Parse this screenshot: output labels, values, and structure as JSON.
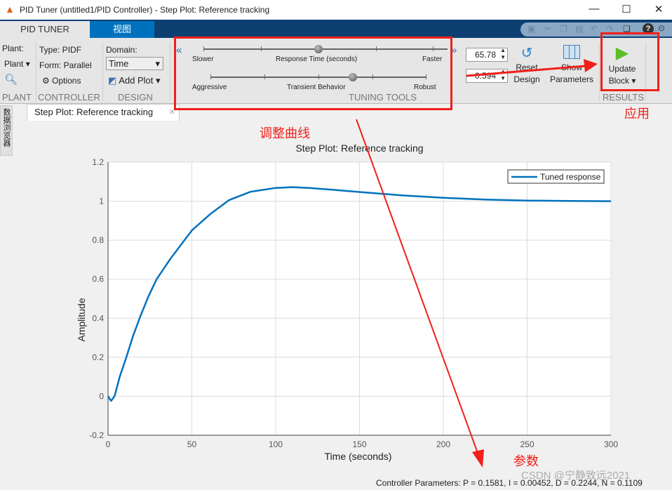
{
  "window": {
    "title": "PID Tuner (untitled1/PID Controller) - Step Plot: Reference tracking",
    "minimize": "—",
    "maximize": "☐",
    "close": "✕"
  },
  "tabs": [
    {
      "label": "PID TUNER"
    },
    {
      "label": "视图"
    }
  ],
  "plant": {
    "label": "Plant:",
    "dropdown": "Plant",
    "section": "PLANT"
  },
  "controller": {
    "type": "Type: PIDF",
    "form": "Form: Parallel",
    "options": "Options",
    "section": "CONTROLLER"
  },
  "design": {
    "domain_label": "Domain:",
    "domain_value": "Time",
    "add_plot": "Add Plot",
    "section": "DESIGN"
  },
  "tuning": {
    "response_left": "Slower",
    "response_mid": "Response Time (seconds)",
    "response_right": "Faster",
    "response_value": 65.78,
    "transient_left": "Aggressive",
    "transient_mid": "Transient Behavior",
    "transient_right": "Robust",
    "transient_value": 0.594,
    "section": "TUNING TOOLS",
    "response_field": "65.78",
    "transient_field": "0.594"
  },
  "actions": {
    "reset_line1": "Reset",
    "reset_line2": "Design",
    "show_line1": "Show",
    "show_line2": "Parameters",
    "update_line1": "Update",
    "update_line2": "Block",
    "section": "RESULTS"
  },
  "sidebar": {
    "label": "数据浏览器"
  },
  "doc_tab": {
    "label": "Step Plot: Reference tracking",
    "close": "✕"
  },
  "annotations": {
    "tune_curve": "调整曲线",
    "apply": "应用",
    "params": "参数",
    "accent": "#f0201a"
  },
  "watermark": "CSDN @宁静致远2021",
  "status": "Controller Parameters: P = 0.1581, I = 0.00452, D = 0.2244, N = 0.1109",
  "chart_data": {
    "type": "line",
    "title": "Step Plot: Reference tracking",
    "xlabel": "Time (seconds)",
    "ylabel": "Amplitude",
    "xlim": [
      0,
      300
    ],
    "ylim": [
      -0.2,
      1.2
    ],
    "grid": true,
    "legend_placement": "top-right",
    "xticks": [
      "0",
      "50",
      "100",
      "150",
      "200",
      "250",
      "300"
    ],
    "yticks": [
      "-0.2",
      "0",
      "0.2",
      "0.4",
      "0.6",
      "0.8",
      "1",
      "1.2"
    ],
    "series": [
      {
        "name": "Tuned response",
        "color": "#0072bd",
        "x": [
          0,
          1.8,
          3.9,
          7,
          10.9,
          15,
          19.3,
          24,
          29,
          37.4,
          50,
          61,
          72.3,
          85,
          100,
          110,
          120,
          135,
          150,
          175,
          200,
          225,
          250,
          275,
          300
        ],
        "y": [
          0,
          -0.024,
          0,
          0.1,
          0.2,
          0.31,
          0.41,
          0.51,
          0.6,
          0.707,
          0.85,
          0.934,
          1.006,
          1.048,
          1.068,
          1.072,
          1.068,
          1.058,
          1.047,
          1.03,
          1.017,
          1.008,
          1.003,
          1.001,
          1.0
        ]
      }
    ]
  }
}
